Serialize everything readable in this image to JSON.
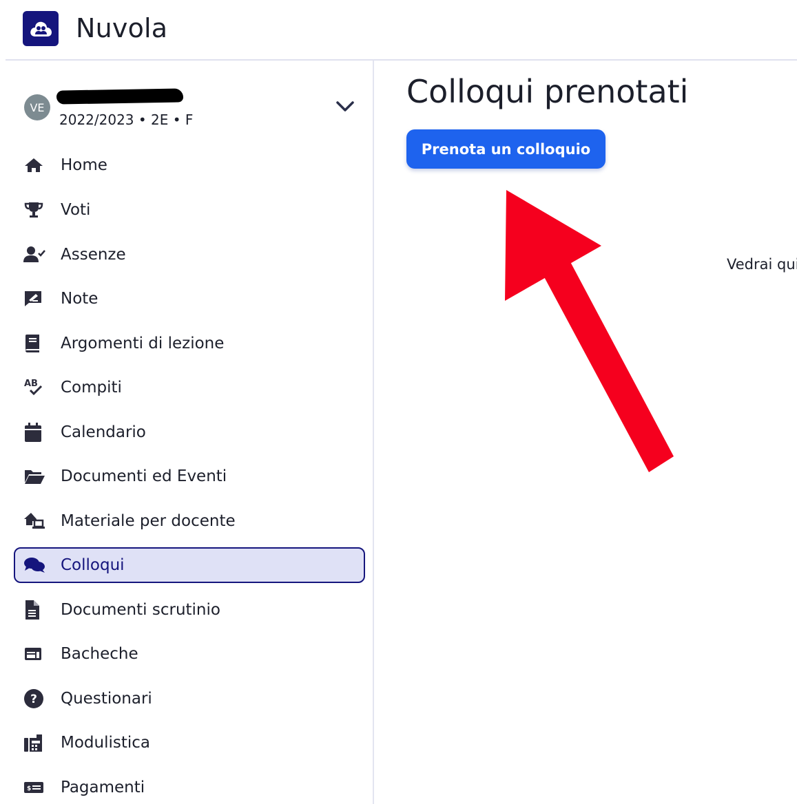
{
  "app": {
    "title": "Nuvola"
  },
  "profile": {
    "avatar_initials": "VE",
    "subtitle": "2022/2023 • 2E • F"
  },
  "sidebar": {
    "items": [
      {
        "label": "Home",
        "icon": "home-icon"
      },
      {
        "label": "Voti",
        "icon": "trophy-icon"
      },
      {
        "label": "Assenze",
        "icon": "user-check-icon"
      },
      {
        "label": "Note",
        "icon": "note-icon"
      },
      {
        "label": "Argomenti di lezione",
        "icon": "book-icon"
      },
      {
        "label": "Compiti",
        "icon": "spellcheck-icon"
      },
      {
        "label": "Calendario",
        "icon": "calendar-icon"
      },
      {
        "label": "Documenti ed Eventi",
        "icon": "folder-open-icon"
      },
      {
        "label": "Materiale per docente",
        "icon": "house-laptop-icon"
      },
      {
        "label": "Colloqui",
        "icon": "comments-icon",
        "active": true
      },
      {
        "label": "Documenti scrutinio",
        "icon": "file-icon"
      },
      {
        "label": "Bacheche",
        "icon": "board-icon"
      },
      {
        "label": "Questionari",
        "icon": "question-circle-icon"
      },
      {
        "label": "Modulistica",
        "icon": "fax-icon"
      },
      {
        "label": "Pagamenti",
        "icon": "money-bill-icon"
      }
    ]
  },
  "main": {
    "title": "Colloqui prenotati",
    "book_button": "Prenota un colloquio",
    "hint_text": "Vedrai qui"
  },
  "colors": {
    "brand": "#15157d",
    "primary_button": "#1e63ee",
    "active_bg": "#dfe1f6",
    "annotation_arrow": "#f5001e"
  }
}
